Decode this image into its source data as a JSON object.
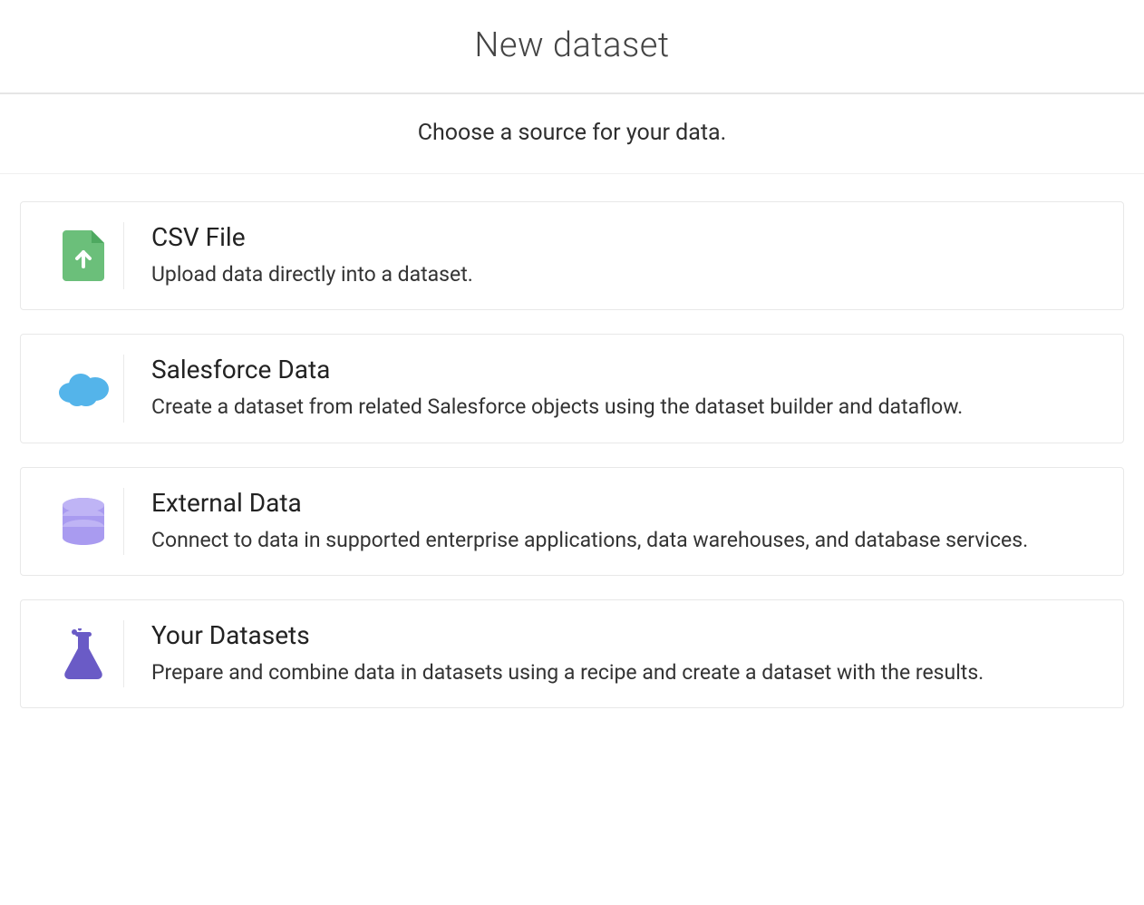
{
  "header": {
    "title": "New dataset"
  },
  "subheader": {
    "text": "Choose a source for your data."
  },
  "options": [
    {
      "icon": "csv-upload-icon",
      "title": "CSV File",
      "description": "Upload data directly into a dataset."
    },
    {
      "icon": "salesforce-cloud-icon",
      "title": "Salesforce Data",
      "description": "Create a dataset from related Salesforce objects using the dataset builder and dataflow."
    },
    {
      "icon": "database-icon",
      "title": "External Data",
      "description": "Connect to data in supported enterprise applications, data warehouses, and database services."
    },
    {
      "icon": "flask-icon",
      "title": "Your Datasets",
      "description": "Prepare and combine data in datasets using a recipe and create a dataset with the results."
    }
  ]
}
